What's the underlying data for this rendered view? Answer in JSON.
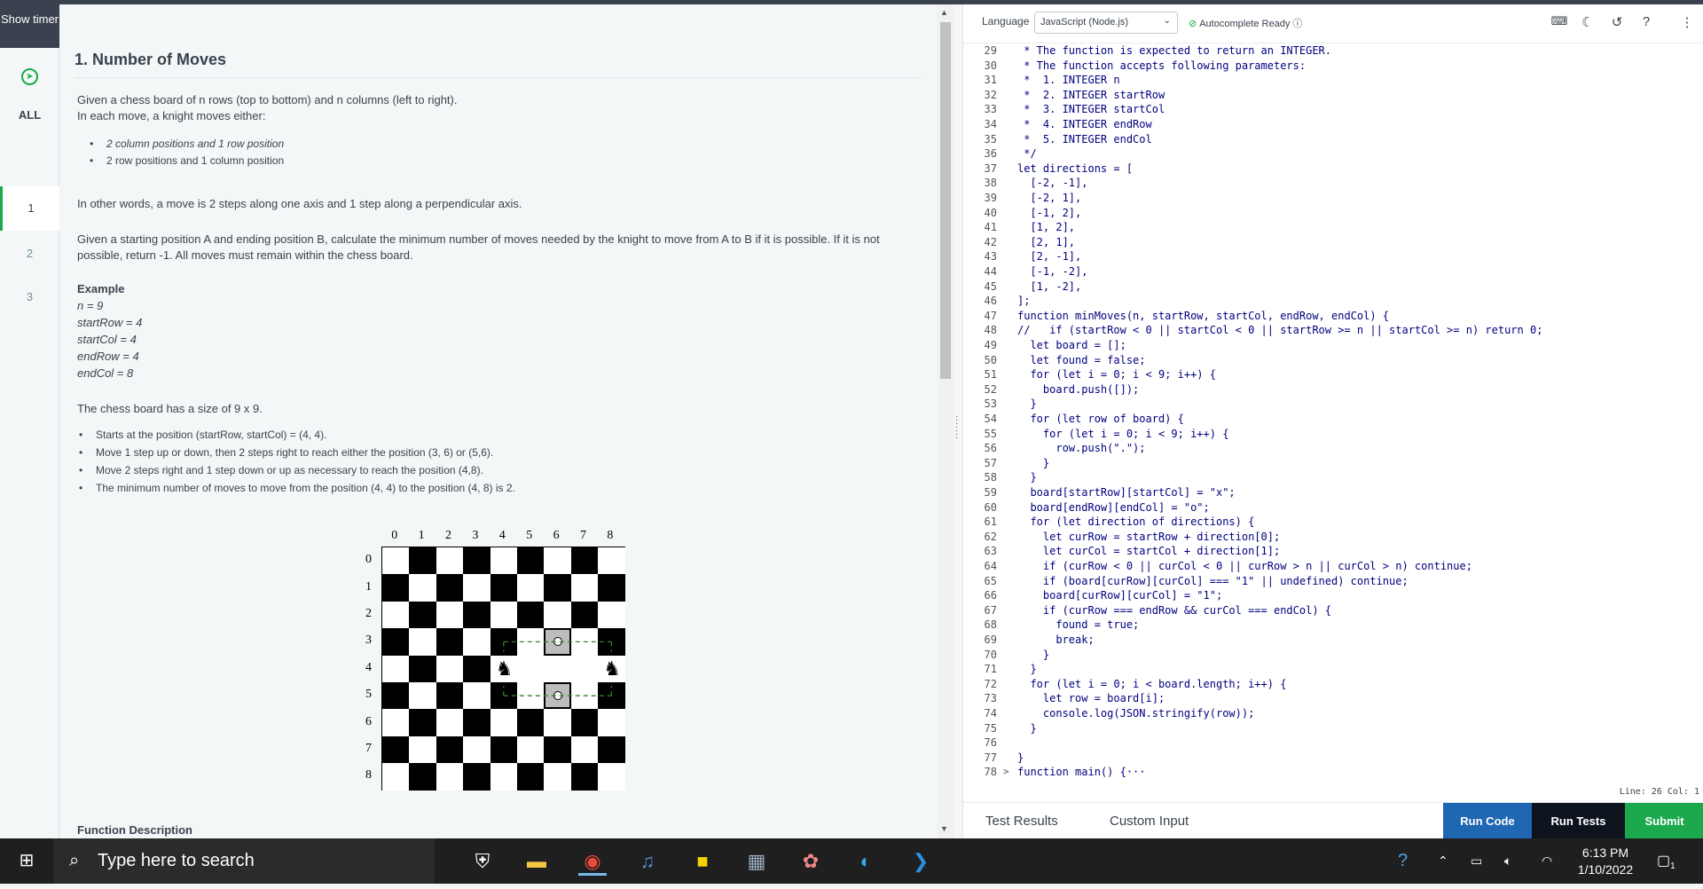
{
  "rail": {
    "show_timer": "Show timer",
    "all_label": "ALL",
    "questions": [
      "1",
      "2",
      "3"
    ]
  },
  "problem": {
    "title": "1. Number of Moves",
    "intro1": "Given a chess board of n rows (top to bottom) and n columns (left to right).",
    "intro2": "In each move, a knight moves either:",
    "moves": [
      "2 column positions and 1 row position",
      "2 row positions and 1 column position"
    ],
    "other_words": "In other words, a move is 2 steps along one axis and 1 step along a perpendicular axis.",
    "given": "Given a starting position A and ending position B, calculate the minimum number of moves needed by the knight to move from A to B if it is possible. If it is not possible, return -1. All moves must remain within the chess board.",
    "example_label": "Example",
    "example_lines": [
      "n = 9",
      "startRow = 4",
      "startCol = 4",
      "endRow = 4",
      "endCol = 8"
    ],
    "board_size": "The chess board has a size of  9 x 9.",
    "steps": [
      "Starts at the position (startRow, startCol) = (4, 4).",
      "Move 1 step up or down, then 2 steps right to reach either the position (3, 6) or (5,6).",
      "Move 2 steps right and 1 step down or up as necessary to reach the position (4,8).",
      "The minimum number of moves to move from the position (4, 4) to the position (4, 8) is 2."
    ],
    "board_cols": [
      "0",
      "1",
      "2",
      "3",
      "4",
      "5",
      "6",
      "7",
      "8"
    ],
    "board_rows": [
      "0",
      "1",
      "2",
      "3",
      "4",
      "5",
      "6",
      "7",
      "8"
    ],
    "function_description": "Function Description"
  },
  "editor": {
    "language_label": "Language",
    "language_value": "JavaScript (Node.js)",
    "autocomplete": "Autocomplete Ready",
    "status": "Line: 26 Col: 1",
    "tab_test_results": "Test Results",
    "tab_custom_input": "Custom Input",
    "run_code": "Run Code",
    "run_tests": "Run Tests",
    "submit": "Submit",
    "accent": "#1ba94c",
    "blue": "#1f66b3",
    "lines": [
      {
        "n": "29",
        "t": " * The function is expected to return an INTEGER."
      },
      {
        "n": "30",
        "t": " * The function accepts following parameters:"
      },
      {
        "n": "31",
        "t": " *  1. INTEGER n"
      },
      {
        "n": "32",
        "t": " *  2. INTEGER startRow"
      },
      {
        "n": "33",
        "t": " *  3. INTEGER startCol"
      },
      {
        "n": "34",
        "t": " *  4. INTEGER endRow"
      },
      {
        "n": "35",
        "t": " *  5. INTEGER endCol"
      },
      {
        "n": "36",
        "t": " */"
      },
      {
        "n": "37",
        "t": "let directions = ["
      },
      {
        "n": "38",
        "t": "  [-2, -1],"
      },
      {
        "n": "39",
        "t": "  [-2, 1],"
      },
      {
        "n": "40",
        "t": "  [-1, 2],"
      },
      {
        "n": "41",
        "t": "  [1, 2],"
      },
      {
        "n": "42",
        "t": "  [2, 1],"
      },
      {
        "n": "43",
        "t": "  [2, -1],"
      },
      {
        "n": "44",
        "t": "  [-1, -2],"
      },
      {
        "n": "45",
        "t": "  [1, -2],"
      },
      {
        "n": "46",
        "t": "];"
      },
      {
        "n": "47",
        "t": "function minMoves(n, startRow, startCol, endRow, endCol) {"
      },
      {
        "n": "48",
        "t": "//   if (startRow < 0 || startCol < 0 || startRow >= n || startCol >= n) return 0;"
      },
      {
        "n": "49",
        "t": "  let board = [];"
      },
      {
        "n": "50",
        "t": "  let found = false;"
      },
      {
        "n": "51",
        "t": "  for (let i = 0; i < 9; i++) {"
      },
      {
        "n": "52",
        "t": "    board.push([]);"
      },
      {
        "n": "53",
        "t": "  }"
      },
      {
        "n": "54",
        "t": "  for (let row of board) {"
      },
      {
        "n": "55",
        "t": "    for (let i = 0; i < 9; i++) {"
      },
      {
        "n": "56",
        "t": "      row.push(\".\");"
      },
      {
        "n": "57",
        "t": "    }"
      },
      {
        "n": "58",
        "t": "  }"
      },
      {
        "n": "59",
        "t": "  board[startRow][startCol] = \"x\";"
      },
      {
        "n": "60",
        "t": "  board[endRow][endCol] = \"o\";"
      },
      {
        "n": "61",
        "t": "  for (let direction of directions) {"
      },
      {
        "n": "62",
        "t": "    let curRow = startRow + direction[0];"
      },
      {
        "n": "63",
        "t": "    let curCol = startCol + direction[1];"
      },
      {
        "n": "64",
        "t": "    if (curRow < 0 || curCol < 0 || curRow > n || curCol > n) continue;"
      },
      {
        "n": "65",
        "t": "    if (board[curRow][curCol] === \"1\" || undefined) continue;"
      },
      {
        "n": "66",
        "t": "    board[curRow][curCol] = \"1\";"
      },
      {
        "n": "67",
        "t": "    if (curRow === endRow && curCol === endCol) {"
      },
      {
        "n": "68",
        "t": "      found = true;"
      },
      {
        "n": "69",
        "t": "      break;"
      },
      {
        "n": "70",
        "t": "    }"
      },
      {
        "n": "71",
        "t": "  }"
      },
      {
        "n": "72",
        "t": "  for (let i = 0; i < board.length; i++) {"
      },
      {
        "n": "73",
        "t": "    let row = board[i];"
      },
      {
        "n": "74",
        "t": "    console.log(JSON.stringify(row));"
      },
      {
        "n": "75",
        "t": "  }"
      },
      {
        "n": "76",
        "t": ""
      },
      {
        "n": "77",
        "t": "}"
      },
      {
        "n": "78",
        "t": "function main() {···"
      }
    ]
  },
  "taskbar": {
    "search_placeholder": "Type here to search",
    "time": "6:13 PM",
    "date": "1/10/2022",
    "notification_count": "1"
  }
}
